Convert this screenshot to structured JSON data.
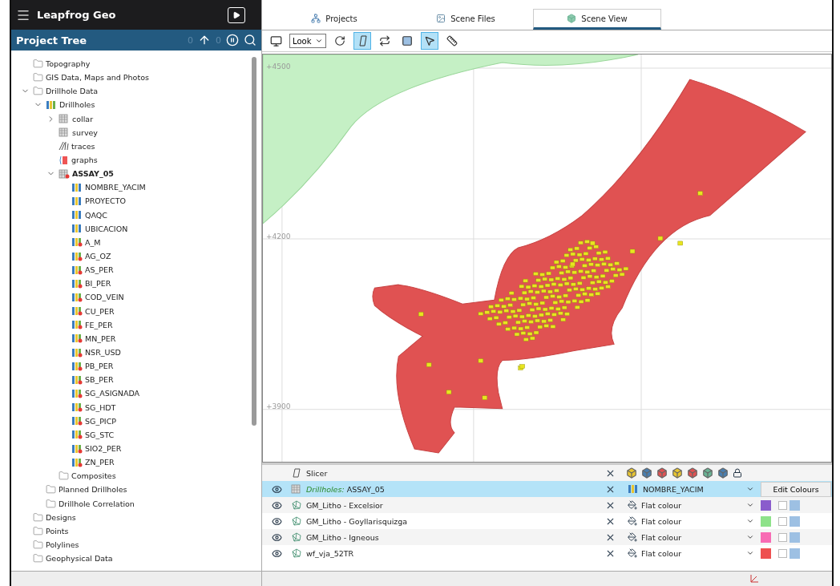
{
  "app": {
    "title": "Leapfrog Geo"
  },
  "tabs": [
    {
      "label": "Projects",
      "kind": "projects",
      "selected": false
    },
    {
      "label": "Scene Files",
      "kind": "files",
      "selected": false
    },
    {
      "label": "Scene View",
      "kind": "scene",
      "selected": true
    }
  ],
  "project_tree": {
    "title": "Project Tree",
    "up_count": "0",
    "pause_count": "0",
    "items": [
      {
        "label": "Topography",
        "kind": "folder"
      },
      {
        "label": "GIS Data, Maps and Photos",
        "kind": "folder"
      },
      {
        "label": "Drillhole Data",
        "kind": "folder",
        "expanded": true,
        "children": [
          {
            "label": "Drillholes",
            "kind": "drillholes",
            "expanded": true,
            "children": [
              {
                "label": "collar",
                "kind": "table",
                "expanded": false
              },
              {
                "label": "survey",
                "kind": "table"
              },
              {
                "label": "traces",
                "kind": "traces"
              },
              {
                "label": "graphs",
                "kind": "graphs"
              },
              {
                "label": "ASSAY_05",
                "kind": "assay",
                "expanded": true,
                "children": [
                  {
                    "label": "NOMBRE_YACIM",
                    "kind": "category"
                  },
                  {
                    "label": "PROYECTO",
                    "kind": "category"
                  },
                  {
                    "label": "QAQC",
                    "kind": "category"
                  },
                  {
                    "label": "UBICACION",
                    "kind": "category"
                  },
                  {
                    "label": "A_M",
                    "kind": "numeric"
                  },
                  {
                    "label": "AG_OZ",
                    "kind": "numeric"
                  },
                  {
                    "label": "AS_PER",
                    "kind": "numeric"
                  },
                  {
                    "label": "BI_PER",
                    "kind": "numeric"
                  },
                  {
                    "label": "COD_VEIN",
                    "kind": "numeric"
                  },
                  {
                    "label": "CU_PER",
                    "kind": "numeric"
                  },
                  {
                    "label": "FE_PER",
                    "kind": "numeric"
                  },
                  {
                    "label": "MN_PER",
                    "kind": "numeric"
                  },
                  {
                    "label": "NSR_USD",
                    "kind": "numeric"
                  },
                  {
                    "label": "PB_PER",
                    "kind": "numeric"
                  },
                  {
                    "label": "SB_PER",
                    "kind": "numeric"
                  },
                  {
                    "label": "SG_ASIGNADA",
                    "kind": "numeric"
                  },
                  {
                    "label": "SG_HDT",
                    "kind": "numeric"
                  },
                  {
                    "label": "SG_PICP",
                    "kind": "numeric"
                  },
                  {
                    "label": "SG_STC",
                    "kind": "numeric"
                  },
                  {
                    "label": "SIO2_PER",
                    "kind": "numeric"
                  },
                  {
                    "label": "ZN_PER",
                    "kind": "numeric"
                  }
                ]
              },
              {
                "label": "Composites",
                "kind": "folder"
              }
            ]
          },
          {
            "label": "Planned Drillholes",
            "kind": "folder"
          },
          {
            "label": "Drillhole Correlation",
            "kind": "folder"
          }
        ]
      },
      {
        "label": "Designs",
        "kind": "folder"
      },
      {
        "label": "Points",
        "kind": "folder"
      },
      {
        "label": "Polylines",
        "kind": "folder"
      },
      {
        "label": "Geophysical Data",
        "kind": "folder"
      }
    ]
  },
  "toolbar": {
    "view_select": "Look"
  },
  "scene": {
    "axis_labels": [
      "+4500",
      "+4200",
      "+3900"
    ]
  },
  "layers": {
    "slicer": {
      "label": "Slicer"
    },
    "rows": [
      {
        "prefix": "Drillholes:",
        "name": "ASSAY_05",
        "kind": "drillholes",
        "visible": true,
        "selected": true,
        "style": "NOMBRE_YACIM",
        "action": "Edit Colours"
      },
      {
        "name": "GM_Litho - Excelsior",
        "kind": "mesh",
        "visible": true,
        "selected": false,
        "style": "Flat colour",
        "color": "#8a5ccc"
      },
      {
        "name": "GM_Litho - Goyllarisquizga",
        "kind": "mesh",
        "visible": true,
        "selected": false,
        "style": "Flat colour",
        "color": "#8ee28a"
      },
      {
        "name": "GM_Litho - Igneous",
        "kind": "mesh",
        "visible": true,
        "selected": false,
        "style": "Flat colour",
        "color": "#f86bb4"
      },
      {
        "name": "wf_vja_52TR",
        "kind": "mesh",
        "visible": true,
        "selected": false,
        "style": "Flat colour",
        "color": "#ee5050"
      }
    ]
  }
}
